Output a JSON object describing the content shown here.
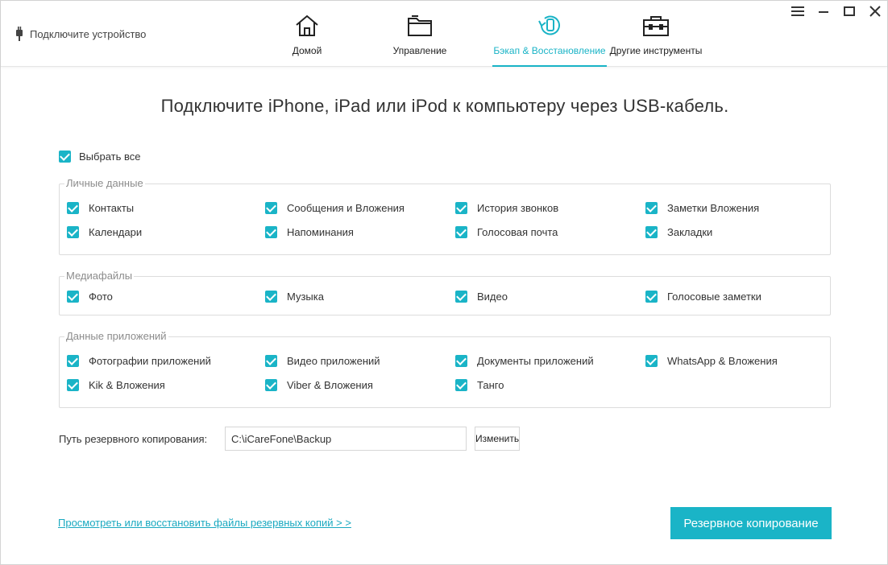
{
  "header": {
    "device_status": "Подключите устройство",
    "tabs": [
      {
        "label": "Домой",
        "icon": "home-icon"
      },
      {
        "label": "Управление",
        "icon": "folder-icon"
      },
      {
        "label": "Бэкап & Восстановление",
        "icon": "backup-restore-icon",
        "active": true
      },
      {
        "label": "Другие инструменты",
        "icon": "toolbox-icon"
      }
    ],
    "accent_color": "#19b3c6"
  },
  "main": {
    "headline": "Подключите iPhone, iPad или iPod к компьютеру через USB-кабель.",
    "select_all": {
      "label": "Выбрать все",
      "checked": true
    },
    "groups": [
      {
        "title": "Личные данные",
        "items": [
          {
            "label": "Контакты",
            "checked": true
          },
          {
            "label": "Сообщения и Вложения",
            "checked": true
          },
          {
            "label": "История звонков",
            "checked": true
          },
          {
            "label": "Заметки Вложения",
            "checked": true
          },
          {
            "label": "Календари",
            "checked": true
          },
          {
            "label": "Напоминания",
            "checked": true
          },
          {
            "label": "Голосовая почта",
            "checked": true
          },
          {
            "label": "Закладки",
            "checked": true
          }
        ]
      },
      {
        "title": "Медиафайлы",
        "items": [
          {
            "label": "Фото",
            "checked": true
          },
          {
            "label": "Музыка",
            "checked": true
          },
          {
            "label": "Видео",
            "checked": true
          },
          {
            "label": "Голосовые заметки",
            "checked": true
          }
        ]
      },
      {
        "title": "Данные приложений",
        "items": [
          {
            "label": "Фотографии приложений",
            "checked": true
          },
          {
            "label": "Видео приложений",
            "checked": true
          },
          {
            "label": "Документы приложений",
            "checked": true
          },
          {
            "label": "WhatsApp & Вложения",
            "checked": true
          },
          {
            "label": "Kik & Вложения",
            "checked": true
          },
          {
            "label": "Viber & Вложения",
            "checked": true
          },
          {
            "label": "Танго",
            "checked": true
          }
        ]
      }
    ],
    "backup_path": {
      "label": "Путь резервного копирования:",
      "value": "C:\\iCareFone\\Backup",
      "change_label": "Изменить"
    },
    "view_link": "Просмотреть или восстановить файлы резервных копий > >",
    "backup_button": "Резервное копирование"
  }
}
